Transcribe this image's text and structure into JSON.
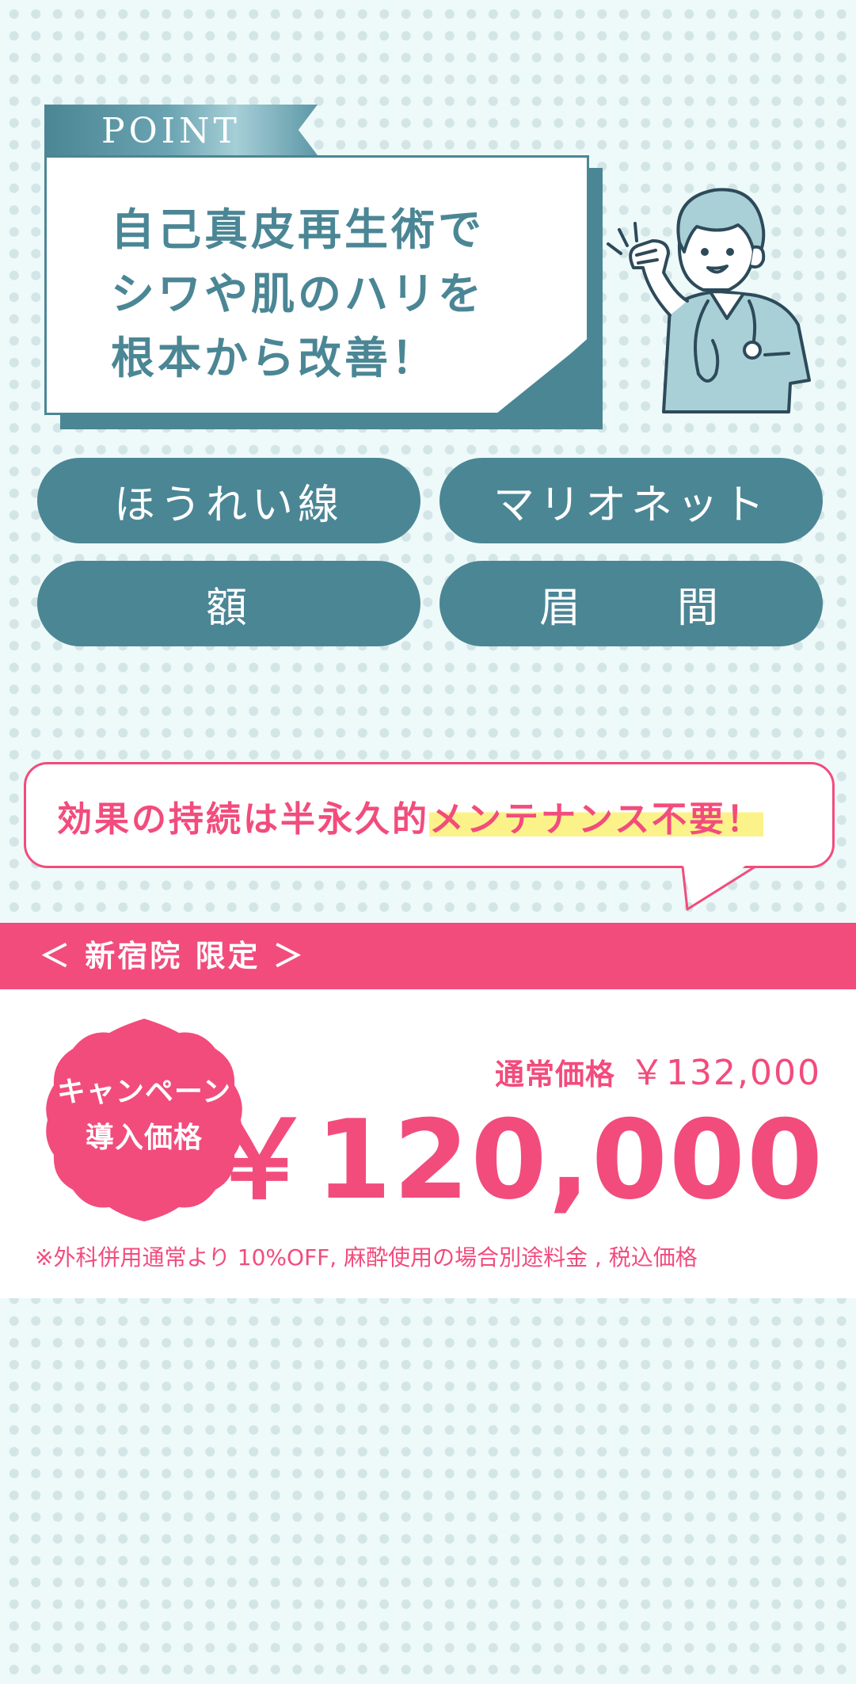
{
  "point": {
    "tag": "POINT",
    "headline_lines": [
      "自己真皮再生術で",
      "シワや肌のハリを",
      "根本から改善！"
    ]
  },
  "targets": [
    "ほうれい線",
    "マリオネット",
    "額",
    "眉　　間"
  ],
  "effect": {
    "text_main": "効果の持続は半永久的",
    "text_highlight": "メンテナンス不要！"
  },
  "campaign": {
    "band_label": "＜ 新宿院 限定 ＞",
    "badge_line1": "キャンペーン",
    "badge_line2": "導入価格",
    "regular_label": "通常価格",
    "regular_price": "￥132,000",
    "campaign_price": "￥120,000",
    "note": "※外科併用通常より 10%OFF, 麻酔使用の場合別途料金 , 税込価格"
  },
  "colors": {
    "teal": "#4b8695",
    "pink": "#f24c7c",
    "highlight": "#fbf38a",
    "background": "#eefafa"
  },
  "icons": [
    "doctor-illustration",
    "wave-lines-icon"
  ]
}
